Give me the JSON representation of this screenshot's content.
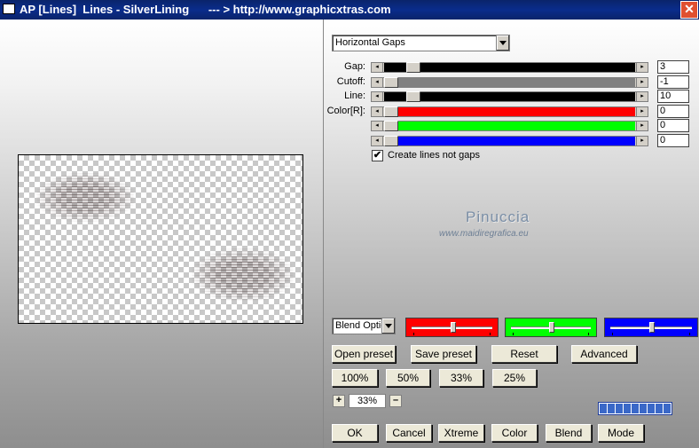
{
  "window": {
    "title": "AP [Lines]  Lines - SilverLining      --- > http://www.graphicxtras.com",
    "close_glyph": "✕"
  },
  "mode_dropdown": {
    "value": "Horizontal Gaps"
  },
  "params": [
    {
      "label": "Gap:",
      "value": "3",
      "track_color": "#000000",
      "level": 0.04
    },
    {
      "label": "Cutoff:",
      "value": "-1",
      "track_color": "#808080",
      "level": 0.0
    },
    {
      "label": "Line:",
      "value": "10",
      "track_color": "#000000",
      "level": 0.04
    },
    {
      "label": "Color[R]:",
      "value": "0",
      "track_color": "#ff0000",
      "level": 0.0
    },
    {
      "label": "",
      "value": "0",
      "track_color": "#00ff00",
      "level": 0.0
    },
    {
      "label": "",
      "value": "0",
      "track_color": "#0000ff",
      "level": 0.0
    }
  ],
  "checkbox": {
    "label": "Create lines not gaps",
    "checked": true,
    "mark": "✔"
  },
  "watermark": {
    "title": "Pinuccia",
    "subtitle": "www.maidiregrafica.eu"
  },
  "blend_dropdown": {
    "value": "Blend Optio"
  },
  "color_sliders": [
    {
      "color": "#ff0000",
      "level": 0.5
    },
    {
      "color": "#00ff00",
      "level": 0.5
    },
    {
      "color": "#0000ff",
      "level": 0.5
    }
  ],
  "buttons_row1": [
    "Open preset",
    "Save preset",
    "Reset",
    "Advanced"
  ],
  "zoom_buttons": [
    "100%",
    "50%",
    "33%",
    "25%"
  ],
  "zoom": {
    "plus": "+",
    "value": "33%",
    "minus": "–"
  },
  "progress_segments": 9,
  "bottom_buttons": [
    "OK",
    "Cancel",
    "Xtreme",
    "Color",
    "Blend",
    "Mode"
  ]
}
